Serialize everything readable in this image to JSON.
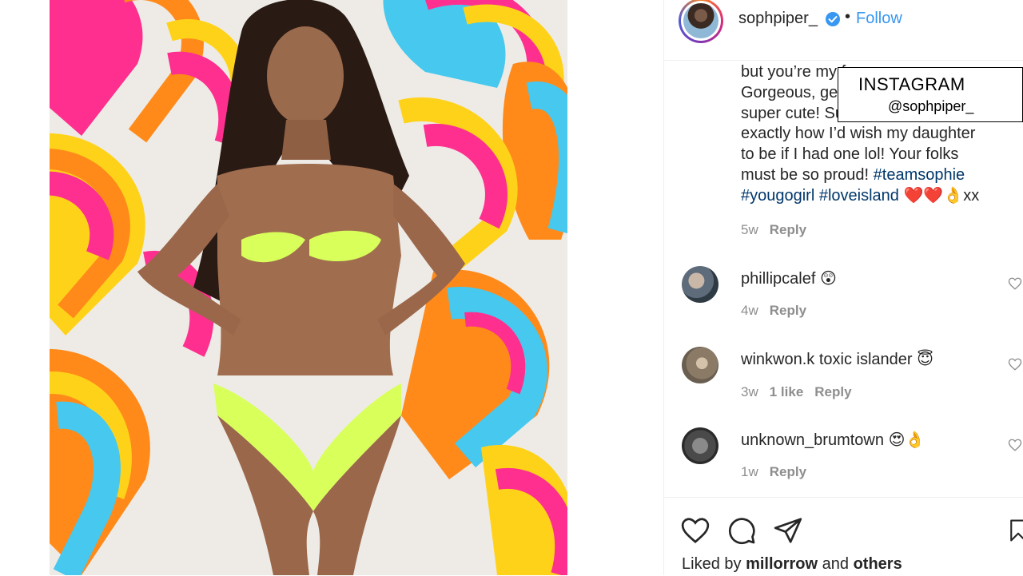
{
  "post": {
    "username": "sophpiper_",
    "follow_label": "Follow",
    "dot": "•"
  },
  "caption": {
    "line1": "but you’re my fa",
    "line2": "Gorgeous, ge",
    "line3": "super cute! Su",
    "line4": "exactly how I’d wish my daughter",
    "line5": "to be if I had one lol! Your folks",
    "line6": "must be so proud! ",
    "tag1": "#teamsophie",
    "tag2": "#yougogirl",
    "tag3": "#loveisland",
    "emoji_end": "❤️❤️👌xx",
    "age": "5w",
    "reply": "Reply"
  },
  "comments": [
    {
      "user": "phillipcalef",
      "text": "😲",
      "age": "4w",
      "likes": "",
      "reply": "Reply"
    },
    {
      "user": "winkwon.k",
      "text": "toxic islander 😇",
      "age": "3w",
      "likes": "1 like",
      "reply": "Reply"
    },
    {
      "user": "unknown_brumtown",
      "text": "😍👌",
      "age": "1w",
      "likes": "",
      "reply": "Reply"
    }
  ],
  "watermark": {
    "title": "INSTAGRAM",
    "handle": "@sophpiper_"
  },
  "footer": {
    "liked_by_prefix": "Liked by ",
    "liked_by_user": "millorrow",
    "liked_by_mid": " and ",
    "liked_by_others": "others"
  },
  "icons": [
    "heart-icon",
    "comment-icon",
    "share-icon",
    "bookmark-icon",
    "verified-icon"
  ],
  "colors": {
    "link": "#3897f0",
    "hashtag": "#00376b",
    "meta": "#8e8e8e",
    "bikini": "#d8ff5a"
  }
}
